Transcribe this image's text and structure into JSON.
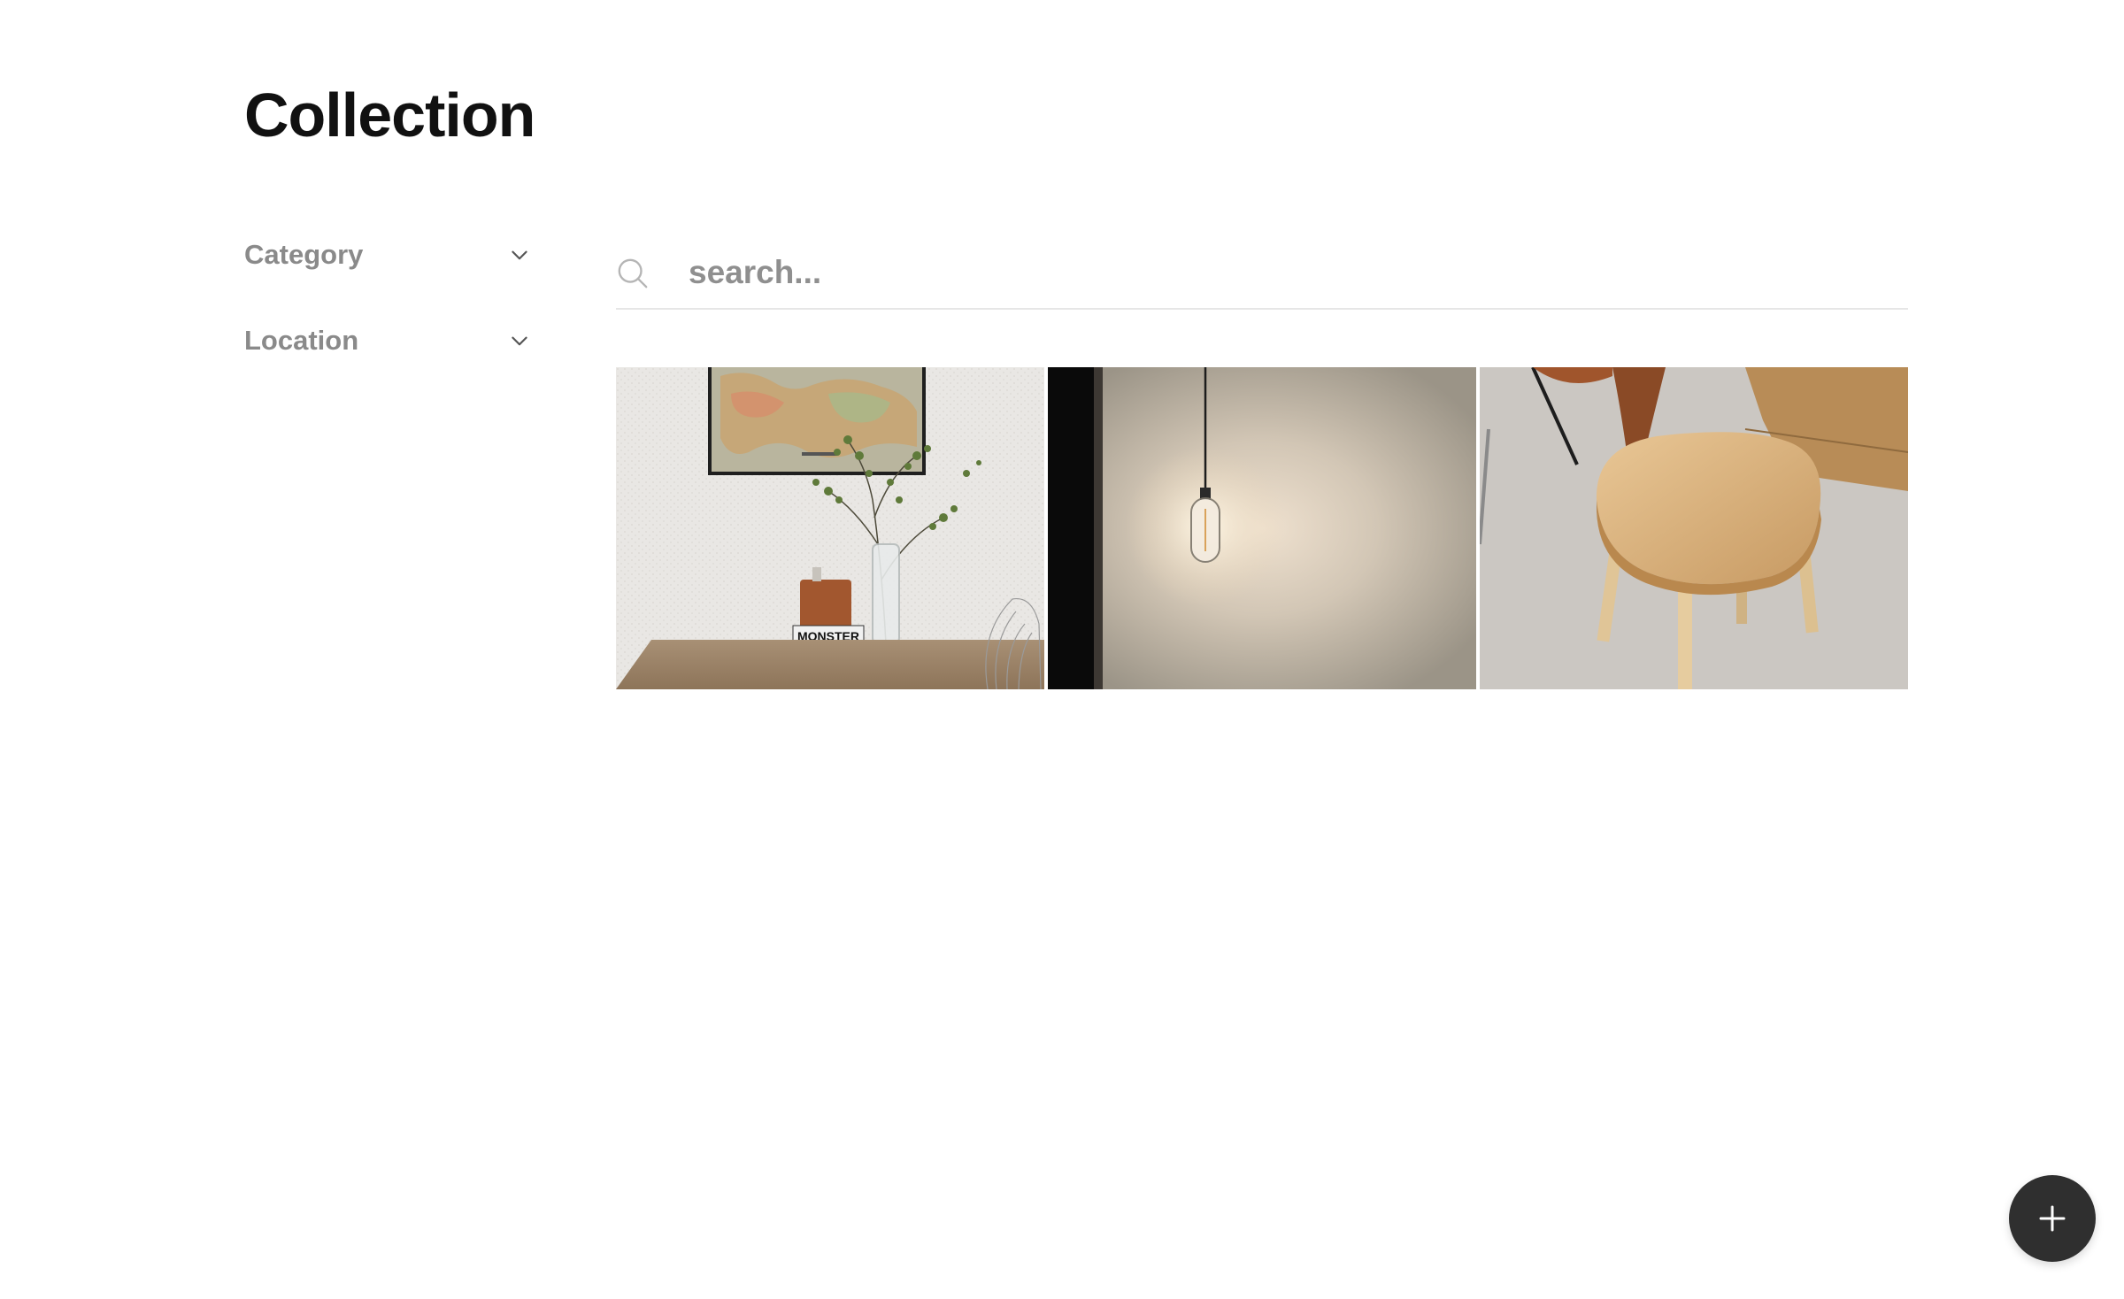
{
  "page": {
    "title": "Collection"
  },
  "filters": [
    {
      "label": "Category",
      "icon": "chevron-down-icon"
    },
    {
      "label": "Location",
      "icon": "chevron-down-icon"
    }
  ],
  "search": {
    "placeholder": "search...",
    "value": "",
    "icon": "search-icon"
  },
  "gallery": {
    "items": [
      {
        "subject": "table-with-vase-and-map",
        "sign_text": "MONSTER"
      },
      {
        "subject": "pendant-lamp"
      },
      {
        "subject": "wooden-chair"
      }
    ]
  },
  "fab": {
    "icon": "plus-icon"
  },
  "colors": {
    "title": "#111111",
    "muted_text": "#8a8a8a",
    "divider": "#e6e6e6",
    "fab_background": "#2f2f2f"
  }
}
